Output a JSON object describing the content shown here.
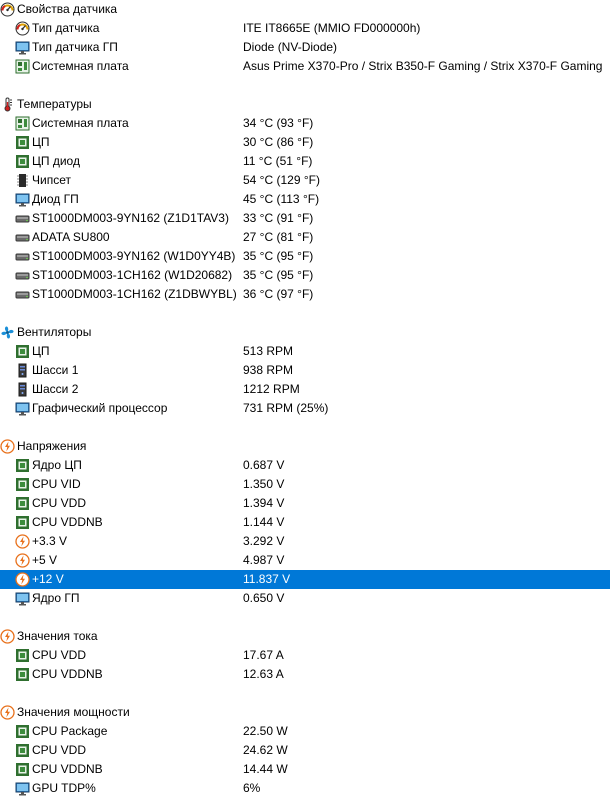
{
  "groups": [
    {
      "title": "Свойства датчика",
      "icon": "sensor-gauge-icon",
      "items": [
        {
          "label": "Тип датчика",
          "value": "ITE IT8665E  (MMIO FD000000h)",
          "icon": "sensor-gauge-icon"
        },
        {
          "label": "Тип датчика ГП",
          "value": "Diode  (NV-Diode)",
          "icon": "gpu-icon"
        },
        {
          "label": "Системная плата",
          "value": "Asus Prime X370-Pro / Strix B350-F Gaming / Strix X370-F Gaming",
          "icon": "motherboard-icon"
        }
      ]
    },
    {
      "title": "Температуры",
      "icon": "thermometer-icon",
      "items": [
        {
          "label": "Системная плата",
          "value": "34 °C  (93 °F)",
          "icon": "motherboard-icon"
        },
        {
          "label": "ЦП",
          "value": "30 °C  (86 °F)",
          "icon": "cpu-chip-icon"
        },
        {
          "label": "ЦП диод",
          "value": "11 °C  (51 °F)",
          "icon": "cpu-chip-icon"
        },
        {
          "label": "Чипсет",
          "value": "54 °C  (129 °F)",
          "icon": "chipset-icon"
        },
        {
          "label": "Диод ГП",
          "value": "45 °C  (113 °F)",
          "icon": "gpu-icon"
        },
        {
          "label": "ST1000DM003-9YN162 (Z1D1TAV3)",
          "value": "33 °C  (91 °F)",
          "icon": "hdd-icon"
        },
        {
          "label": "ADATA SU800",
          "value": "27 °C  (81 °F)",
          "icon": "hdd-icon"
        },
        {
          "label": "ST1000DM003-9YN162 (W1D0YY4B)",
          "value": "35 °C  (95 °F)",
          "icon": "hdd-icon"
        },
        {
          "label": "ST1000DM003-1CH162 (W1D20682)",
          "value": "35 °C  (95 °F)",
          "icon": "hdd-icon"
        },
        {
          "label": "ST1000DM003-1CH162 (Z1DBWYBL)",
          "value": "36 °C  (97 °F)",
          "icon": "hdd-icon"
        }
      ]
    },
    {
      "title": "Вентиляторы",
      "icon": "fan-icon",
      "items": [
        {
          "label": "ЦП",
          "value": "513 RPM",
          "icon": "cpu-chip-icon"
        },
        {
          "label": "Шасси 1",
          "value": "938 RPM",
          "icon": "case-icon"
        },
        {
          "label": "Шасси 2",
          "value": "1212 RPM",
          "icon": "case-icon"
        },
        {
          "label": "Графический процессор",
          "value": "731 RPM  (25%)",
          "icon": "gpu-icon"
        }
      ]
    },
    {
      "title": "Напряжения",
      "icon": "voltage-icon",
      "items": [
        {
          "label": "Ядро ЦП",
          "value": "0.687 V",
          "icon": "cpu-chip-icon"
        },
        {
          "label": "CPU VID",
          "value": "1.350 V",
          "icon": "cpu-chip-icon"
        },
        {
          "label": "CPU VDD",
          "value": "1.394 V",
          "icon": "cpu-chip-icon"
        },
        {
          "label": "CPU VDDNB",
          "value": "1.144 V",
          "icon": "cpu-chip-icon"
        },
        {
          "label": "+3.3 V",
          "value": "3.292 V",
          "icon": "voltage-icon"
        },
        {
          "label": "+5 V",
          "value": "4.987 V",
          "icon": "voltage-icon"
        },
        {
          "label": "+12 V",
          "value": "11.837 V",
          "icon": "voltage-icon",
          "selected": true
        },
        {
          "label": "Ядро ГП",
          "value": "0.650 V",
          "icon": "gpu-icon"
        }
      ]
    },
    {
      "title": "Значения тока",
      "icon": "voltage-icon",
      "items": [
        {
          "label": "CPU VDD",
          "value": "17.67 A",
          "icon": "cpu-chip-icon"
        },
        {
          "label": "CPU VDDNB",
          "value": "12.63 A",
          "icon": "cpu-chip-icon"
        }
      ]
    },
    {
      "title": "Значения мощности",
      "icon": "voltage-icon",
      "items": [
        {
          "label": "CPU Package",
          "value": "22.50 W",
          "icon": "cpu-chip-icon"
        },
        {
          "label": "CPU VDD",
          "value": "24.62 W",
          "icon": "cpu-chip-icon"
        },
        {
          "label": "CPU VDDNB",
          "value": "14.44 W",
          "icon": "cpu-chip-icon"
        },
        {
          "label": "GPU TDP%",
          "value": "6%",
          "icon": "gpu-icon"
        }
      ]
    }
  ],
  "colors": {
    "selection": "#0078d7",
    "chip_green": "#3c7d3c",
    "voltage_orange": "#e8701a",
    "fan_blue": "#1a8fd8"
  }
}
